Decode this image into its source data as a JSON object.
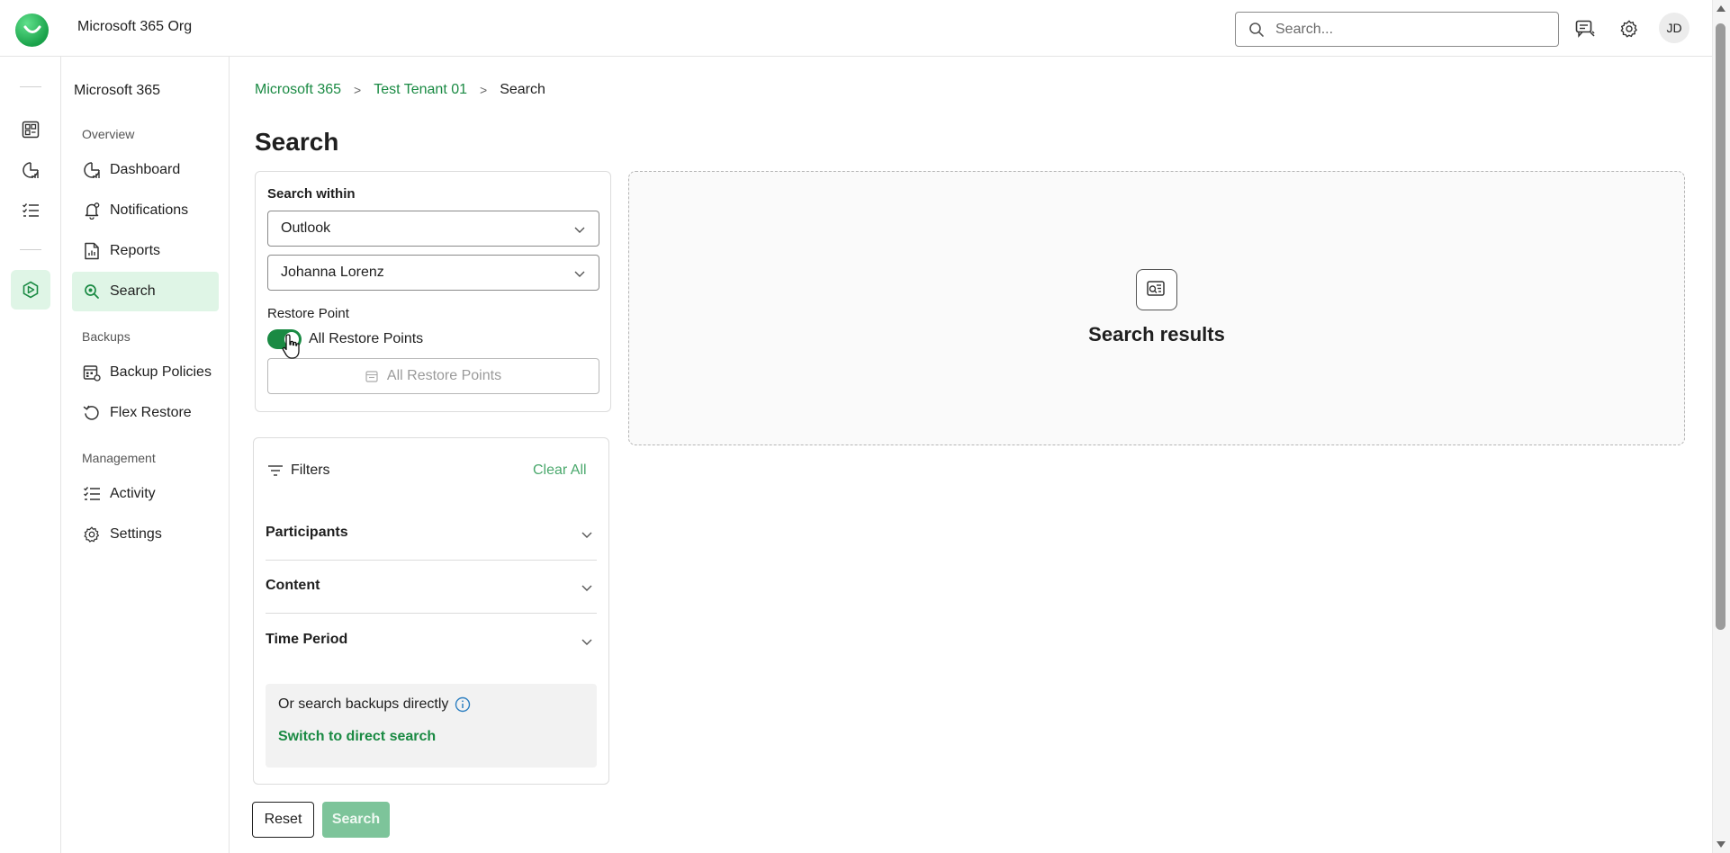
{
  "header": {
    "org_name": "Microsoft 365 Org",
    "search_placeholder": "Search...",
    "avatar_initials": "JD"
  },
  "sidebar": {
    "title": "Microsoft 365",
    "sections": {
      "overview": "Overview",
      "backups": "Backups",
      "management": "Management"
    },
    "items": [
      {
        "label": "Dashboard",
        "icon": "dashboard-gauge-icon"
      },
      {
        "label": "Notifications",
        "icon": "bell-icon"
      },
      {
        "label": "Reports",
        "icon": "report-document-icon"
      },
      {
        "label": "Search",
        "icon": "search-icon",
        "active": true
      },
      {
        "label": "Backup Policies",
        "icon": "policy-calendar-icon"
      },
      {
        "label": "Flex Restore",
        "icon": "restore-arrow-icon"
      },
      {
        "label": "Activity",
        "icon": "activity-list-icon"
      },
      {
        "label": "Settings",
        "icon": "gear-icon"
      }
    ]
  },
  "breadcrumb": [
    "Microsoft 365",
    "Test Tenant 01",
    "Search"
  ],
  "page_title": "Search",
  "search_form": {
    "search_within_label": "Search within",
    "service_value": "Outlook",
    "user_value": "Johanna Lorenz",
    "restore_point_label": "Restore Point",
    "toggle_label": "All Restore Points",
    "toggle_on": true,
    "restore_point_button": "All Restore Points"
  },
  "filters": {
    "title": "Filters",
    "clear_all": "Clear All",
    "sections": [
      "Participants",
      "Content",
      "Time Period"
    ],
    "direct_text": "Or search backups directly",
    "direct_link": "Switch to direct search"
  },
  "actions": {
    "reset": "Reset",
    "search": "Search"
  },
  "results": {
    "title": "Search results"
  },
  "colors": {
    "accent": "#1a8a43",
    "active_bg": "#dff5e6",
    "disabled_button": "#7dc49a"
  }
}
